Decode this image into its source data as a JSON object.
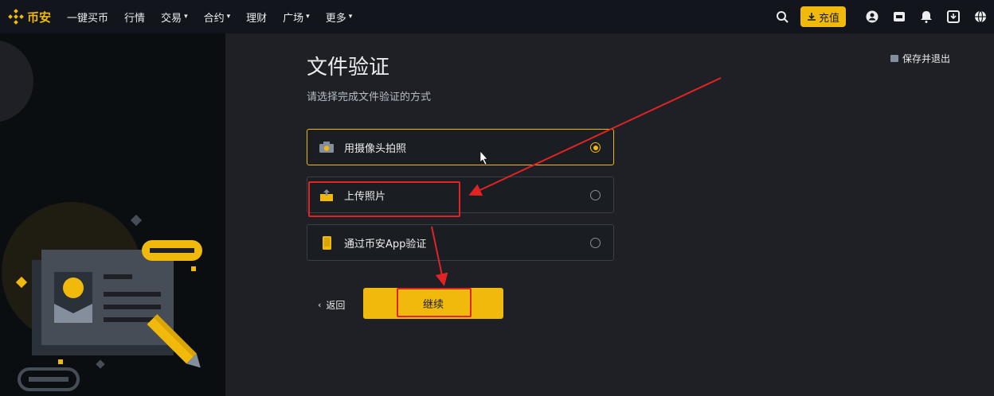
{
  "brand": {
    "name": "币安",
    "color": "#f0b90b"
  },
  "nav": {
    "items": [
      {
        "label": "一键买币",
        "dropdown": false
      },
      {
        "label": "行情",
        "dropdown": false
      },
      {
        "label": "交易",
        "dropdown": true
      },
      {
        "label": "合约",
        "dropdown": true
      },
      {
        "label": "理财",
        "dropdown": false
      },
      {
        "label": "广场",
        "dropdown": true
      },
      {
        "label": "更多",
        "dropdown": true
      }
    ],
    "deposit_label": "充值",
    "right_icons": [
      "search-icon",
      "user-icon",
      "wallet-icon",
      "bell-icon",
      "download-icon",
      "globe-icon"
    ]
  },
  "page": {
    "title": "文件验证",
    "subtitle": "请选择完成文件验证的方式",
    "save_exit": "保存并退出",
    "options": [
      {
        "label": "用摄像头拍照",
        "icon": "camera-icon",
        "selected": true
      },
      {
        "label": "上传照片",
        "icon": "upload-icon",
        "selected": false
      },
      {
        "label": "通过币安App验证",
        "icon": "phone-icon",
        "selected": false
      }
    ],
    "back_label": "返回",
    "continue_label": "继续"
  },
  "colors": {
    "accent": "#f0b90b",
    "background": "#1e2026",
    "topbar": "#12161c",
    "annotation": "#e02424"
  }
}
